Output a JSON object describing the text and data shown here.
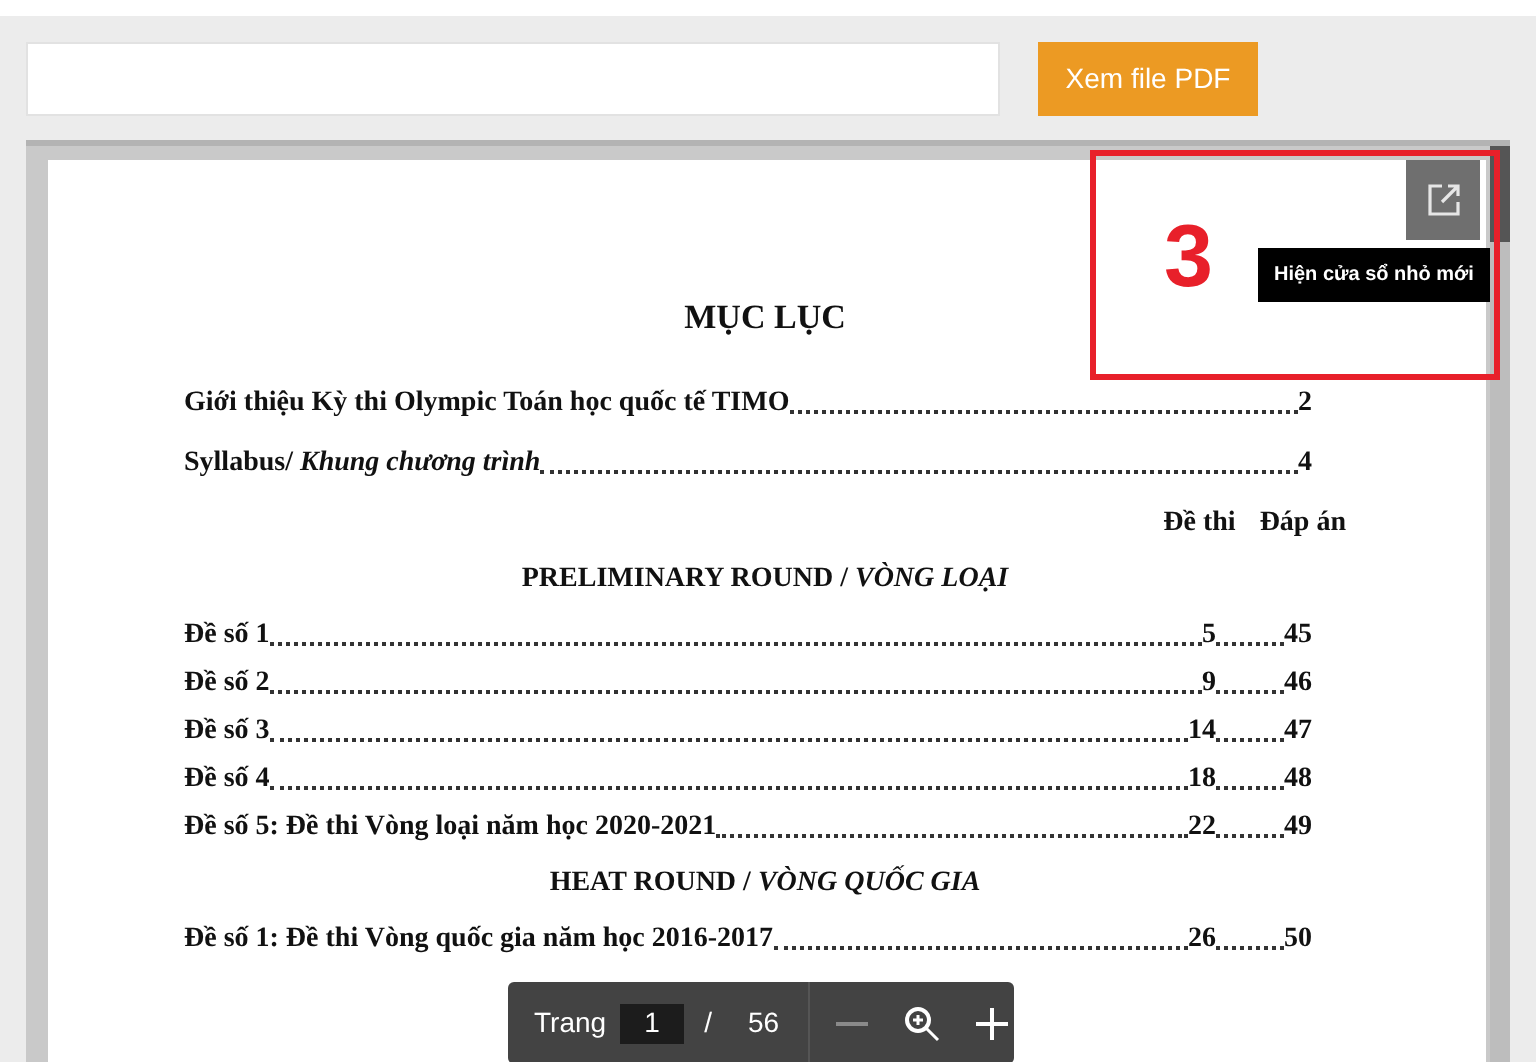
{
  "view_button": {
    "label": "Xem file PDF"
  },
  "annotation": {
    "label": "3"
  },
  "popout": {
    "tooltip": "Hiện cửa sổ nhỏ mới"
  },
  "document": {
    "title": "MỤC LỤC",
    "rows": [
      {
        "kind": "entry",
        "text": "Giới thiệu Kỳ thi Olympic Toán học quốc tế TIMO",
        "page": "2"
      },
      {
        "kind": "entry",
        "text": "Syllabus/ *Khung chương trình*",
        "page": "4"
      },
      {
        "kind": "columns",
        "col_1": "Đề thi",
        "col_2": "Đáp án"
      },
      {
        "kind": "heading",
        "text": "PRELIMINARY ROUND / *VÒNG LOẠI*"
      },
      {
        "kind": "pair",
        "text": "Đề số 1",
        "page": "5",
        "answer_page": "45"
      },
      {
        "kind": "pair",
        "text": "Đề số 2",
        "page": "9",
        "answer_page": "46"
      },
      {
        "kind": "pair",
        "text": "Đề số 3",
        "page": "14",
        "answer_page": "47"
      },
      {
        "kind": "pair",
        "text": "Đề số 4",
        "page": "18",
        "answer_page": "48"
      },
      {
        "kind": "pair",
        "text": "Đề số 5: Đề thi Vòng loại năm học 2020-2021",
        "page": "22",
        "answer_page": "49"
      },
      {
        "kind": "heading",
        "text": "HEAT ROUND / *VÒNG QUỐC GIA*"
      },
      {
        "kind": "pair",
        "text": "Đề số 1: Đề thi Vòng quốc gia năm học 2016-2017",
        "page": "26",
        "answer_page": "50"
      }
    ]
  },
  "toolbar": {
    "page_label": "Trang",
    "page_value": "1",
    "separator": "/",
    "page_count": "56"
  }
}
